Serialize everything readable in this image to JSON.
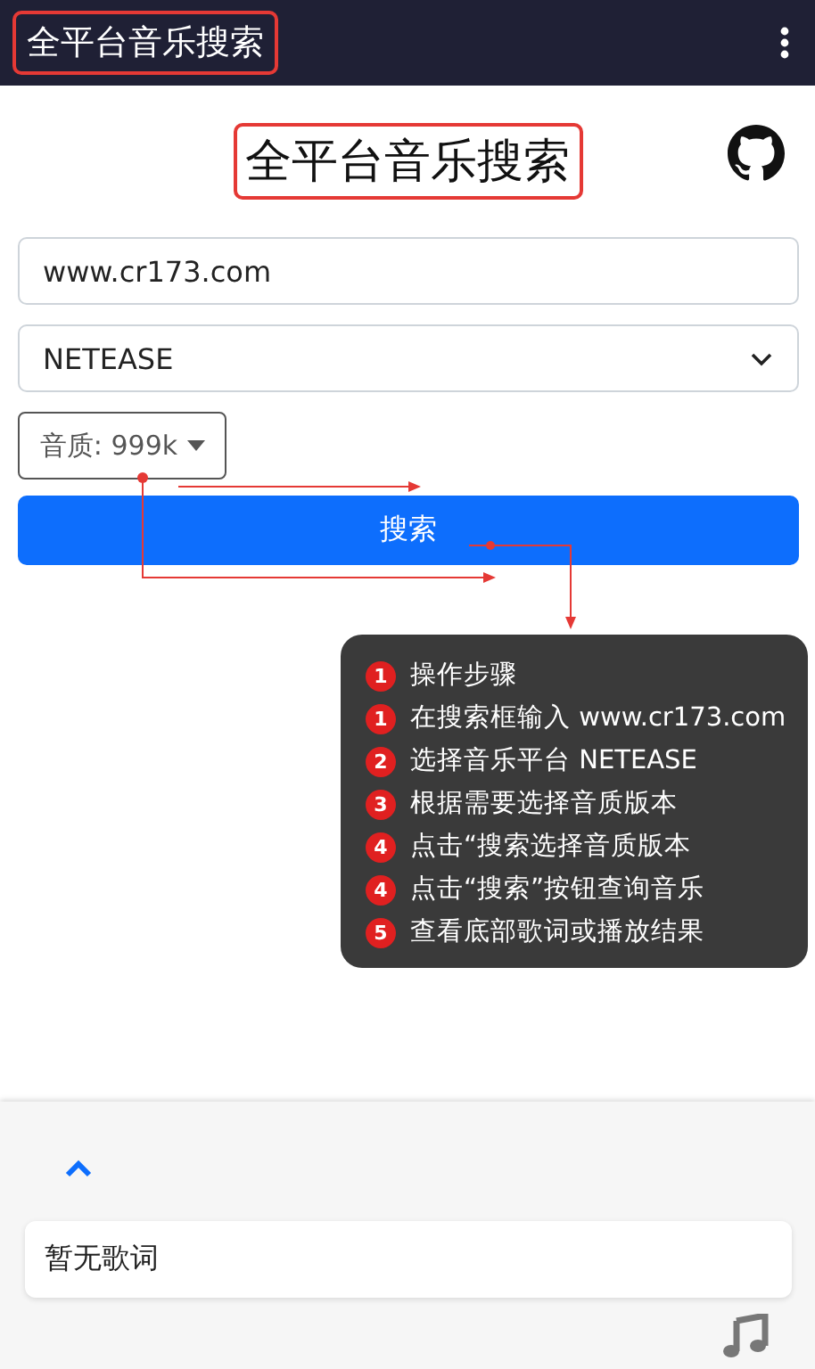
{
  "app_bar": {
    "title": "全平台音乐搜索",
    "title_annotated": true
  },
  "heading": {
    "text": "全平台音乐搜索",
    "annotated": true
  },
  "search": {
    "value": "www.cr173.com"
  },
  "platform": {
    "value": "NETEASE"
  },
  "quality": {
    "label": "音质: 999k"
  },
  "search_button": {
    "label": "搜索"
  },
  "callout": {
    "steps": [
      {
        "number": "1",
        "text": "操作步骤"
      },
      {
        "number": "1",
        "text": "在搜索框输入 www.cr173.com"
      },
      {
        "number": "2",
        "text": "选择音乐平台 NETEASE"
      },
      {
        "number": "3",
        "text": "根据需要选择音质版本"
      },
      {
        "number": "4",
        "text": "点击“搜索选择音质版本"
      },
      {
        "number": "4",
        "text": "点击“搜索”按钮查询音乐"
      },
      {
        "number": "5",
        "text": "查看底部歌词或播放结果"
      }
    ]
  },
  "lyrics": {
    "expanded": false,
    "text": "暂无歌词"
  }
}
